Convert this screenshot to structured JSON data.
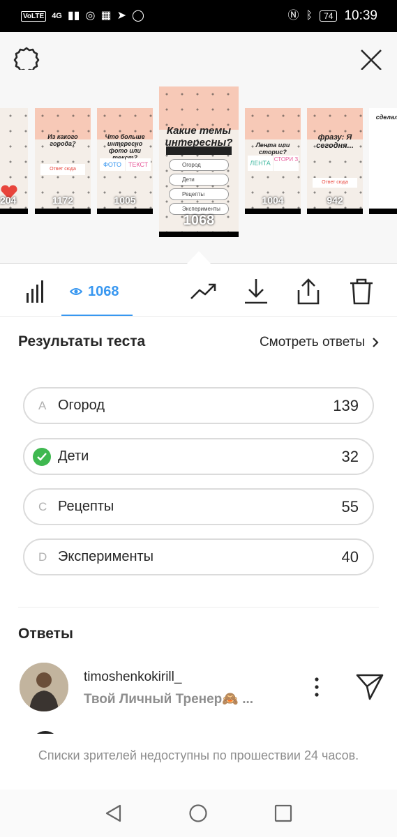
{
  "status_bar": {
    "left_chip": "VoLTE",
    "network": "4G",
    "battery": "74",
    "time": "10:39"
  },
  "carousel": {
    "thumbs": [
      {
        "count": "204"
      },
      {
        "count": "1172",
        "question": "Из какого города?",
        "answer": "Ответ сюда"
      },
      {
        "count": "1005",
        "question": "Что больше интересно фото или текст?",
        "opt_a": "ФОТО",
        "opt_b": "ТЕКСТ"
      },
      {
        "count": "1068",
        "question": "Какие темы интересны?",
        "options": [
          "Огород",
          "Дети",
          "Рецепты",
          "Эксперименты"
        ]
      },
      {
        "count": "1004",
        "question": "Лента или сторис?",
        "opt_a": "ЛЕНТА",
        "opt_b": "СТОРИ З"
      },
      {
        "count": "942",
        "question": "фразу: Я сегодня...",
        "answer": "Ответ сюда"
      },
      {
        "count": "",
        "question": "сделал до с..."
      }
    ]
  },
  "toolbar": {
    "views": "1068"
  },
  "results": {
    "title": "Результаты теста",
    "see_answers": "Смотреть ответы",
    "options": [
      {
        "letter": "A",
        "label": "Огород",
        "count": "139",
        "correct": false
      },
      {
        "letter": "",
        "label": "Дети",
        "count": "32",
        "correct": true
      },
      {
        "letter": "C",
        "label": "Рецепты",
        "count": "55",
        "correct": false
      },
      {
        "letter": "D",
        "label": "Эксперименты",
        "count": "40",
        "correct": false
      }
    ]
  },
  "answers": {
    "title": "Ответы",
    "items": [
      {
        "username": "timoshenkokirill_",
        "bio": "Твой Личный Тренер🙈 ..."
      }
    ]
  },
  "footer_note": "Списки зрителей недоступны по прошествии 24 часов.",
  "colors": {
    "accent": "#3897f0",
    "correct": "#3fb850",
    "text": "#262626",
    "muted": "#8e8e8e"
  }
}
